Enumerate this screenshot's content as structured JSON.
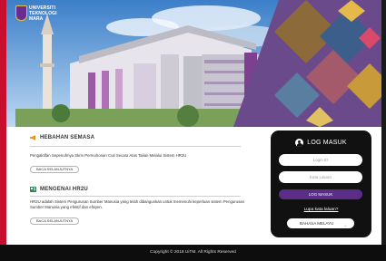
{
  "brand": {
    "logo_text": [
      "UNIVERSITI",
      "TEKNOLOGI",
      "MARA"
    ],
    "accent_red": "#c8102e",
    "accent_purple": "#5a2d86"
  },
  "announcement": {
    "icon": "megaphone-icon",
    "title": "HEBAHAN SEMASA",
    "text": "Pengaktifan Sepenuhnya Skrin Permohonan Cuti Secara Atas Talian Melalui Sistem HR2U",
    "read_more": "BACA SELANJUTNYA"
  },
  "about": {
    "icon": "info-card-icon",
    "title": "MENGENAI HR2U",
    "text": "HR2U adalah Sistem Pengurusan Sumber Manusia yang telah dibangunkan untuk memenuhi keperluan sistem Pengurusan Sumber Manusia yang efektif dan efisyen.",
    "read_more": "BACA SELANJUTNYA"
  },
  "login": {
    "icon": "user-circle-icon",
    "title": "LOG MASUK",
    "login_id_placeholder": "Login ID",
    "password_placeholder": "Kata Laluan",
    "submit_label": "LOG MASUK",
    "forgot_password": "Lupa kata laluan?",
    "language_selected": "BAHASA MELAYU"
  },
  "footer": {
    "copyright": "Copyright © 2018 UiTM. All Rights Reserved"
  }
}
